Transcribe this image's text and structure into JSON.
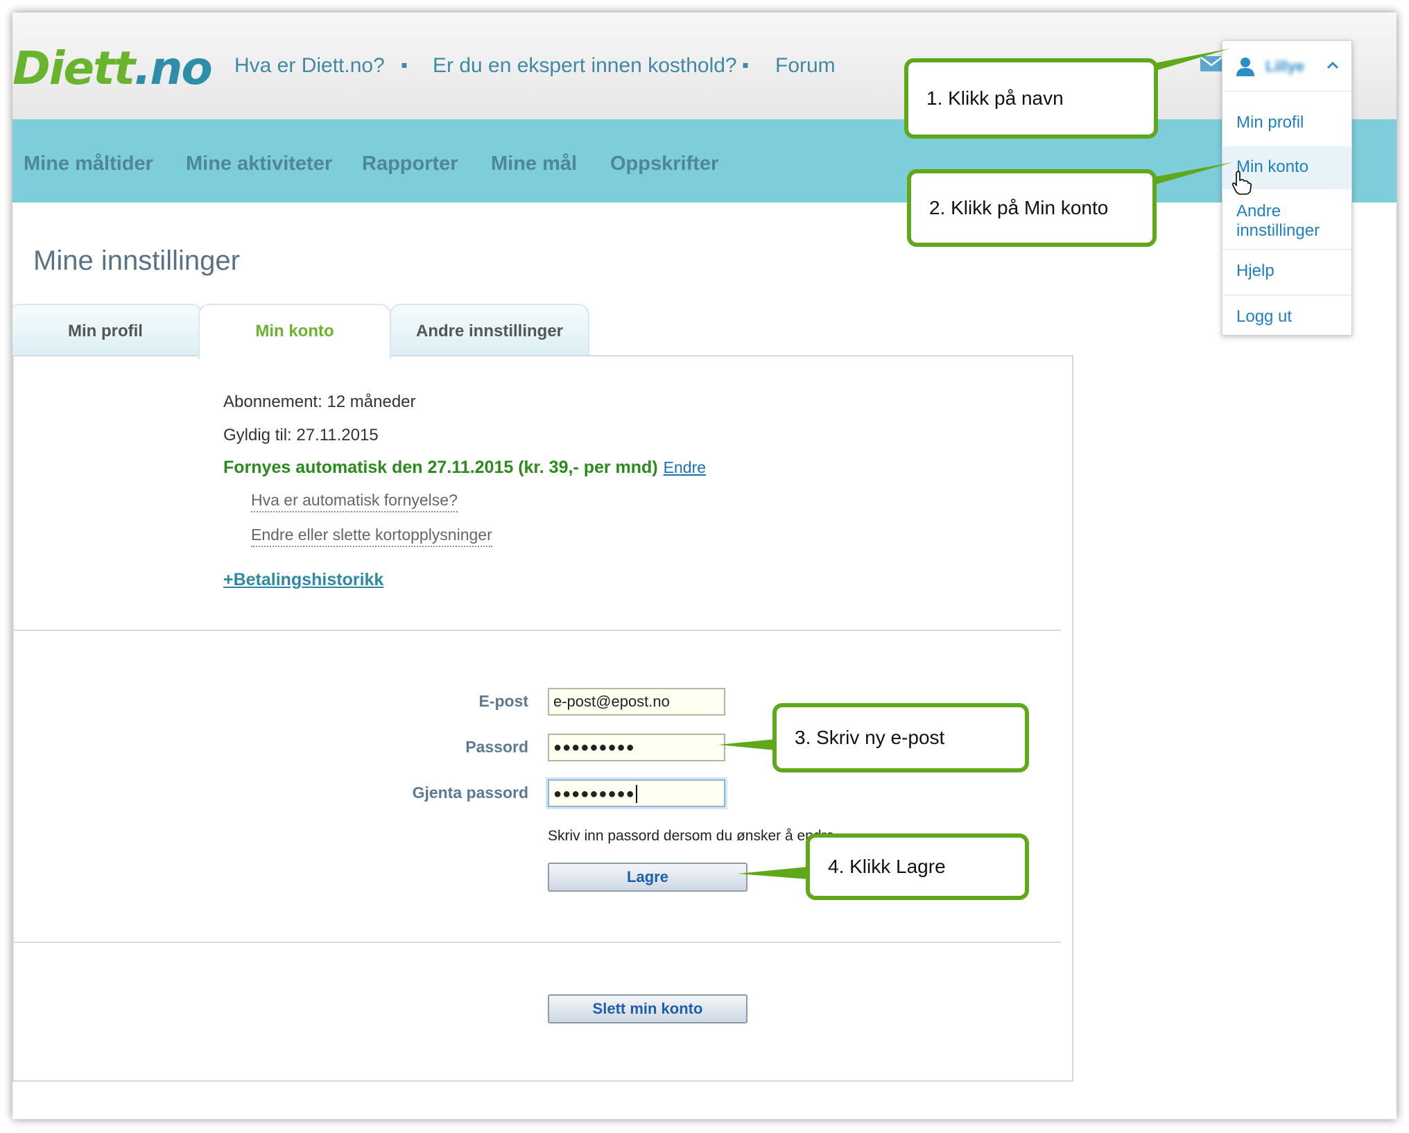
{
  "header": {
    "logo_text": "Diett",
    "logo_suffix": ".no",
    "links": [
      "Hva er Diett.no?",
      "Er du en ekspert innen kosthold?",
      "Forum"
    ],
    "separator": "▪"
  },
  "nav": {
    "items": [
      "Mine måltider",
      "Mine aktiviteter",
      "Rapporter",
      "Mine mål",
      "Oppskrifter"
    ]
  },
  "page": {
    "title": "Mine innstillinger"
  },
  "tabs": [
    "Min profil",
    "Min konto",
    "Andre innstillinger"
  ],
  "account": {
    "subscription": "Abonnement: 12 måneder",
    "valid_until": "Gyldig til: 27.11.2015",
    "renewal": "Fornyes automatisk den 27.11.2015 (kr. 39,- per mnd)",
    "renewal_link": "Endre",
    "auto_renew_link": "Hva er automatisk fornyelse?",
    "card_link": "Endre eller slette kortopplysninger",
    "payment_history": "+Betalingshistorikk"
  },
  "form": {
    "email_label": "E-post",
    "email_value": "e-post@epost.no",
    "password_label": "Passord",
    "password_value": "●●●●●●●●●",
    "repeat_label": "Gjenta passord",
    "repeat_value": "●●●●●●●●●",
    "hint": "Skriv inn passord dersom du ønsker å endre",
    "save_label": "Lagre",
    "delete_label": "Slett min konto"
  },
  "dropdown": {
    "user_name": "Lillye",
    "items": [
      "Min profil",
      "Min konto",
      "Andre innstillinger",
      "Hjelp",
      "Logg ut"
    ]
  },
  "callouts": [
    "1. Klikk på navn",
    "2. Klikk på Min konto",
    "3. Skriv ny e-post",
    "4. Klikk  Lagre"
  ],
  "colors": {
    "accent_green": "#5fa81a",
    "nav_bar": "#7ecddb",
    "link_blue": "#1f7fc2"
  }
}
